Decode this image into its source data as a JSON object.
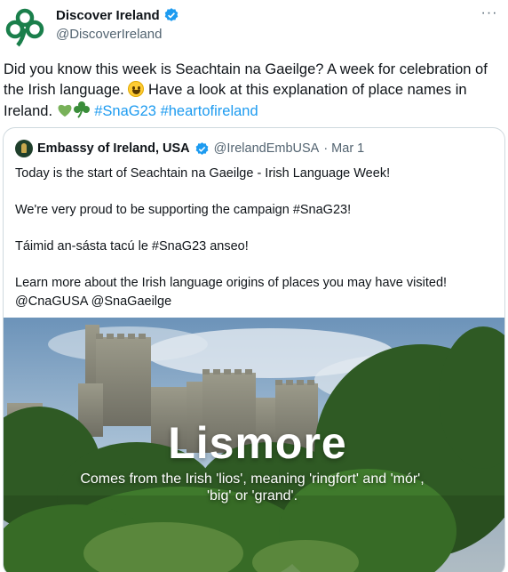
{
  "author": {
    "name": "Discover Ireland",
    "handle": "@DiscoverIreland",
    "avatar_icon": "shamrock-logo",
    "brand_color": "#1a7f4b"
  },
  "tweet": {
    "text_plain": "Did you know this week is Seachtain na Gaeilge? A week for celebration of the Irish language.",
    "text_after_emoji": "Have a look at this explanation of place names in Ireland.",
    "hashtags": [
      "#SnaG23",
      "#heartofireland"
    ],
    "emojis": [
      "smiling-face",
      "green-heart",
      "shamrock"
    ]
  },
  "more_menu": "···",
  "quoted": {
    "name": "Embassy of Ireland, USA",
    "handle": "@IrelandEmbUSA",
    "date": "· Mar 1",
    "lines": [
      "Today is the start of Seachtain na Gaeilge - Irish Language Week!",
      "We're very proud to be supporting the campaign #SnaG23!",
      "Táimid an-sásta tacú le #SnaG23 anseo!",
      "Learn more about the Irish language origins of places you may have visited!",
      "@CnaGUSA @SnaGaeilge"
    ]
  },
  "image": {
    "title": "Lismore",
    "subtitle": "Comes from the Irish 'lios', meaning 'ringfort' and 'mór',  'big' or 'grand'."
  },
  "colors": {
    "link": "#1d9bf0",
    "verified": "#1d9bf0",
    "muted": "#536471"
  }
}
